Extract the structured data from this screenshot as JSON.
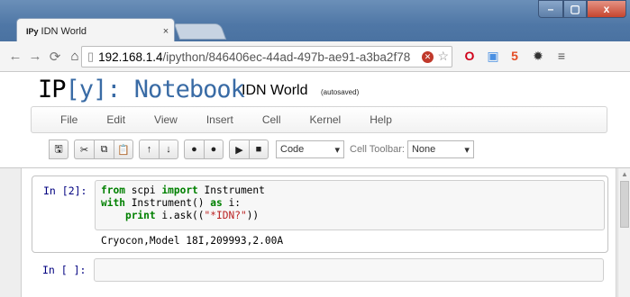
{
  "browser": {
    "tab_favicon": "IPy",
    "tab_title": "IDN World",
    "tab_close": "×",
    "url_host": "192.168.1.4",
    "url_path": "/ipython/846406ec-44ad-497b-ae91-a3ba2f78",
    "window_buttons": {
      "minimize": "–",
      "maximize": "▢",
      "close": "x"
    }
  },
  "notebook": {
    "logo_ip": "IP",
    "logo_y": "[y]:",
    "logo_notebook": " Notebook",
    "name": "IDN World",
    "autosave": "(autosaved)"
  },
  "menu": [
    "File",
    "Edit",
    "View",
    "Insert",
    "Cell",
    "Kernel",
    "Help"
  ],
  "toolbar": {
    "icons": [
      "save-icon",
      "cut-icon",
      "copy-icon",
      "paste-icon",
      "move-up-icon",
      "move-down-icon",
      "insert-above-icon",
      "insert-below-icon",
      "run-icon",
      "stop-icon"
    ],
    "cell_type": "Code",
    "cell_toolbar_label": "Cell Toolbar:",
    "cell_toolbar_value": "None"
  },
  "cells": [
    {
      "prompt": "In [2]:",
      "code": [
        {
          "k1": "from",
          "t1": " scpi ",
          "k2": "import",
          "t2": " Instrument"
        },
        {
          "k1": "with",
          "t1": " Instrument() ",
          "k2": "as",
          "t2": " i:"
        },
        {
          "indent": "    ",
          "k1": "print",
          "t1": " i.ask((",
          "s": "\"*IDN?\"",
          "t2": "))"
        }
      ],
      "output": "Cryocon,Model 18I,209993,2.00A"
    },
    {
      "prompt": "In [ ]:",
      "code": []
    }
  ]
}
